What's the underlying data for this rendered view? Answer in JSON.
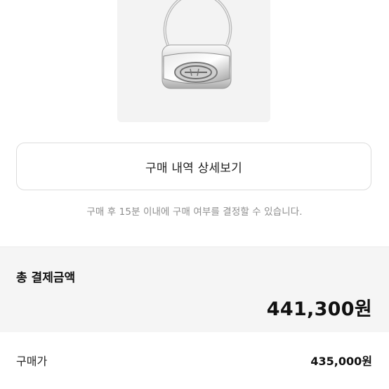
{
  "product": {
    "image_alt": "silver-handbag"
  },
  "detail_button": {
    "label": "구매 내역 상세보기"
  },
  "notice": {
    "text": "구매 후 15분 이내에 구매 여부를 결정할 수 있습니다."
  },
  "total": {
    "label": "총 결제금액",
    "amount": "441,300원"
  },
  "breakdown": {
    "rows": [
      {
        "label": "구매가",
        "value": "435,000원"
      }
    ]
  },
  "colors": {
    "section_bg": "#f5f5f5",
    "border": "#dcdcdc",
    "muted_text": "#8e8e8e"
  }
}
